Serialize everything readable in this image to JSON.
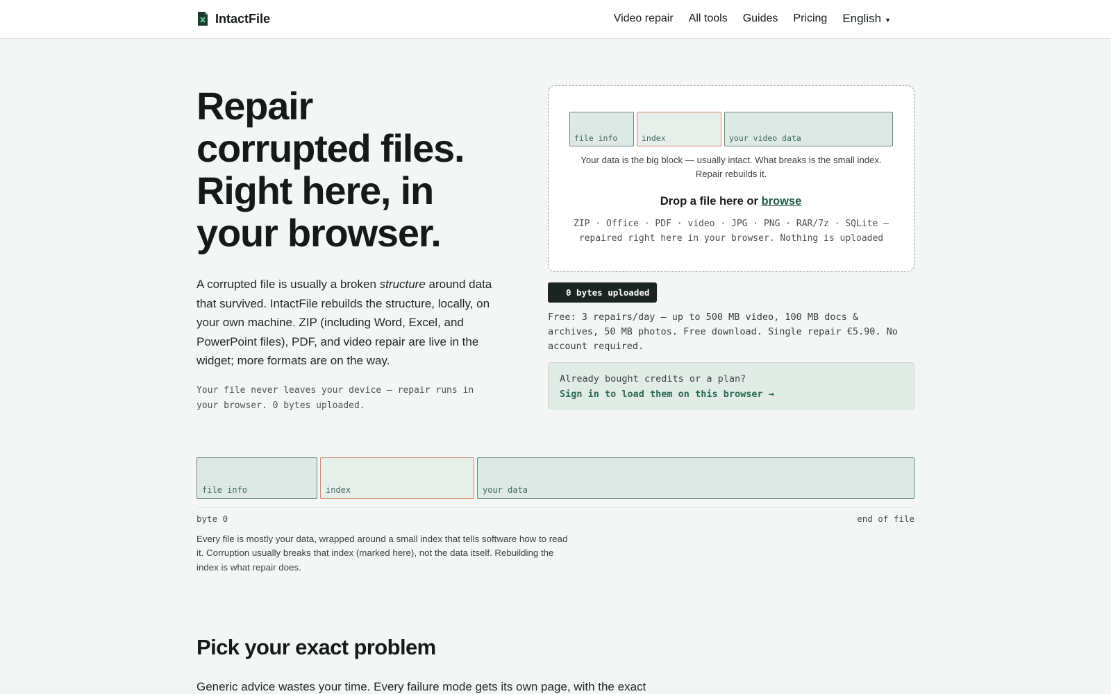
{
  "header": {
    "brand": "IntactFile",
    "nav": [
      "Video repair",
      "All tools",
      "Guides",
      "Pricing"
    ],
    "language": "English"
  },
  "hero": {
    "title_lines": [
      "Repair",
      "corrupted files.",
      "Right here, in",
      "your browser."
    ],
    "desc_before": "A corrupted file is usually a broken ",
    "desc_em": "structure",
    "desc_after": " around data that survived. IntactFile rebuilds the structure, locally, on your own machine. ZIP (including Word, Excel, and PowerPoint files), PDF, and video repair are live in the widget; more formats are on the way.",
    "note": "Your file never leaves your device — repair runs in your browser. 0 bytes uploaded."
  },
  "dropzone": {
    "blocks": [
      "file info",
      "index",
      "your video data"
    ],
    "caption": "Your data is the big block — usually intact. What breaks is the small index. Repair rebuilds it.",
    "drop_text": "Drop a file here or ",
    "browse_link": "browse",
    "formats": "ZIP · Office · PDF · video · JPG · PNG · RAR/7z · SQLite — repaired right here in your browser. Nothing is uploaded"
  },
  "upload_badge": "0 bytes uploaded",
  "free_text": "Free: 3 repairs/day — up to 500 MB video, 100 MB docs & archives, 50 MB photos. Free download. Single repair €5.90. No account required.",
  "signin": {
    "question": "Already bought credits or a plan?",
    "link": "Sign in to load them on this browser →"
  },
  "diagram": {
    "blocks": [
      "file info",
      "index",
      "your data"
    ],
    "start_label": "byte 0",
    "end_label": "end of file",
    "caption": "Every file is mostly your data, wrapped around a small index that tells software how to read it. Corruption usually breaks that index (marked here), not the data itself. Rebuilding the index is what repair does."
  },
  "problems": {
    "title": "Pick your exact problem",
    "desc": "Generic advice wastes your time. Every failure mode gets its own page, with the exact"
  },
  "colors": {
    "accent": "#1f5c45",
    "block_fill": "#dde9e4",
    "block_border": "#5f8a7a",
    "index_border": "#d9846a",
    "badge_bg": "#1a2420"
  }
}
